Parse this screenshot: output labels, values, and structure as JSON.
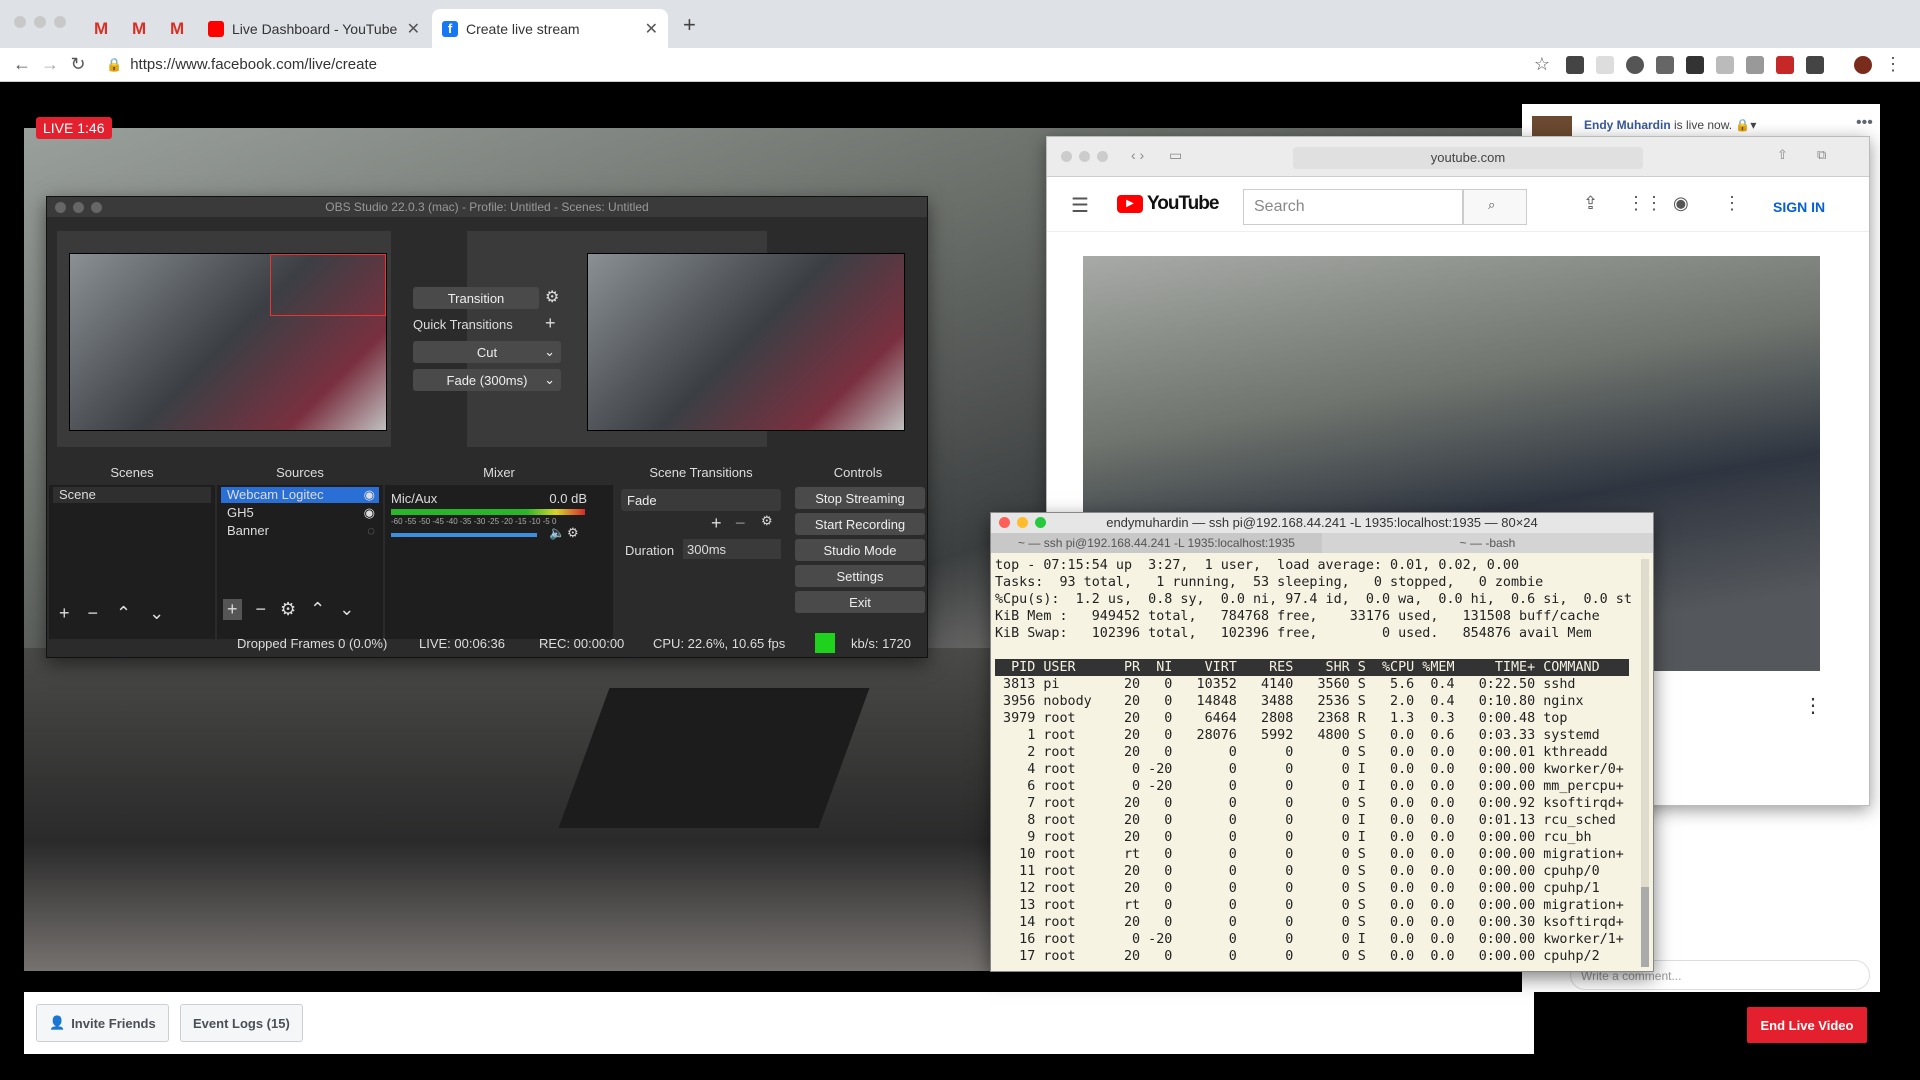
{
  "browser": {
    "tabs": [
      {
        "title": "",
        "icon": "gmail-icon"
      },
      {
        "title": "",
        "icon": "gmail-icon"
      },
      {
        "title": "",
        "icon": "gmail-icon"
      },
      {
        "title": "Live Dashboard - YouTube",
        "icon": "youtube-icon"
      },
      {
        "title": "Create live stream",
        "icon": "facebook-icon"
      }
    ],
    "url": "https://www.facebook.com/live/create"
  },
  "facebook": {
    "live_badge": "LIVE 1:46",
    "user_name": "Endy Muhardin",
    "status": "is live now.",
    "invite_label": "Invite Friends",
    "event_logs_label": "Event Logs (15)",
    "end_live_label": "End Live Video",
    "comment_placeholder": "Write a comment..."
  },
  "youtube": {
    "address": "youtube.com",
    "logo": "YouTube",
    "search_placeholder": "Search",
    "sign_in": "SIGN IN"
  },
  "obs": {
    "title": "OBS Studio 22.0.3 (mac) - Profile: Untitled - Scenes: Untitled",
    "transition_label": "Transition",
    "quick_transitions": "Quick Transitions",
    "cut_label": "Cut",
    "fade_label": "Fade (300ms)",
    "docks": {
      "scenes": "Scenes",
      "sources": "Sources",
      "mixer": "Mixer",
      "scene_transitions": "Scene Transitions",
      "controls": "Controls"
    },
    "scenes": [
      "Scene"
    ],
    "sources": [
      "Webcam Logitec",
      "GH5",
      "Banner"
    ],
    "mixer_channel": "Mic/Aux",
    "mixer_db": "0.0 dB",
    "mixer_ticks": "-60 -55 -50 -45 -40 -35 -30 -25 -20 -15 -10 -5  0",
    "transition_select": "Fade",
    "duration_label": "Duration",
    "duration_value": "300ms",
    "controls": [
      "Stop Streaming",
      "Start Recording",
      "Studio Mode",
      "Settings",
      "Exit"
    ],
    "status": {
      "dropped": "Dropped Frames 0 (0.0%)",
      "live": "LIVE: 00:06:36",
      "rec": "REC: 00:00:00",
      "cpu": "CPU: 22.6%, 10.65 fps",
      "kbs": "kb/s: 1720"
    }
  },
  "terminal": {
    "title": "endymuhardin — ssh pi@192.168.44.241 -L 1935:localhost:1935 — 80×24",
    "tabs": [
      "~ — ssh pi@192.168.44.241 -L 1935:localhost:1935",
      "~ — -bash"
    ],
    "summary": [
      "top - 07:15:54 up  3:27,  1 user,  load average: 0.01, 0.02, 0.00",
      "Tasks:  93 total,   1 running,  53 sleeping,   0 stopped,   0 zombie",
      "%Cpu(s):  1.2 us,  0.8 sy,  0.0 ni, 97.4 id,  0.0 wa,  0.0 hi,  0.6 si,  0.0 st",
      "KiB Mem :   949452 total,   784768 free,    33176 used,   131508 buff/cache",
      "KiB Swap:   102396 total,   102396 free,        0 used.   854876 avail Mem",
      ""
    ],
    "header": "  PID USER      PR  NI    VIRT    RES    SHR S  %CPU %MEM     TIME+ COMMAND",
    "rows": [
      " 3813 pi        20   0   10352   4140   3560 S   5.6  0.4   0:22.50 sshd",
      " 3956 nobody    20   0   14848   3488   2536 S   2.0  0.4   0:10.80 nginx",
      " 3979 root      20   0    6464   2808   2368 R   1.3  0.3   0:00.48 top",
      "    1 root      20   0   28076   5992   4800 S   0.0  0.6   0:03.33 systemd",
      "    2 root      20   0       0      0      0 S   0.0  0.0   0:00.01 kthreadd",
      "    4 root       0 -20       0      0      0 I   0.0  0.0   0:00.00 kworker/0+",
      "    6 root       0 -20       0      0      0 I   0.0  0.0   0:00.00 mm_percpu+",
      "    7 root      20   0       0      0      0 S   0.0  0.0   0:00.92 ksoftirqd+",
      "    8 root      20   0       0      0      0 I   0.0  0.0   0:01.13 rcu_sched",
      "    9 root      20   0       0      0      0 I   0.0  0.0   0:00.00 rcu_bh",
      "   10 root      rt   0       0      0      0 S   0.0  0.0   0:00.00 migration+",
      "   11 root      20   0       0      0      0 S   0.0  0.0   0:00.00 cpuhp/0",
      "   12 root      20   0       0      0      0 S   0.0  0.0   0:00.00 cpuhp/1",
      "   13 root      rt   0       0      0      0 S   0.0  0.0   0:00.00 migration+",
      "   14 root      20   0       0      0      0 S   0.0  0.0   0:00.30 ksoftirqd+",
      "   16 root       0 -20       0      0      0 I   0.0  0.0   0:00.00 kworker/1+",
      "   17 root      20   0       0      0      0 S   0.0  0.0   0:00.00 cpuhp/2"
    ]
  }
}
